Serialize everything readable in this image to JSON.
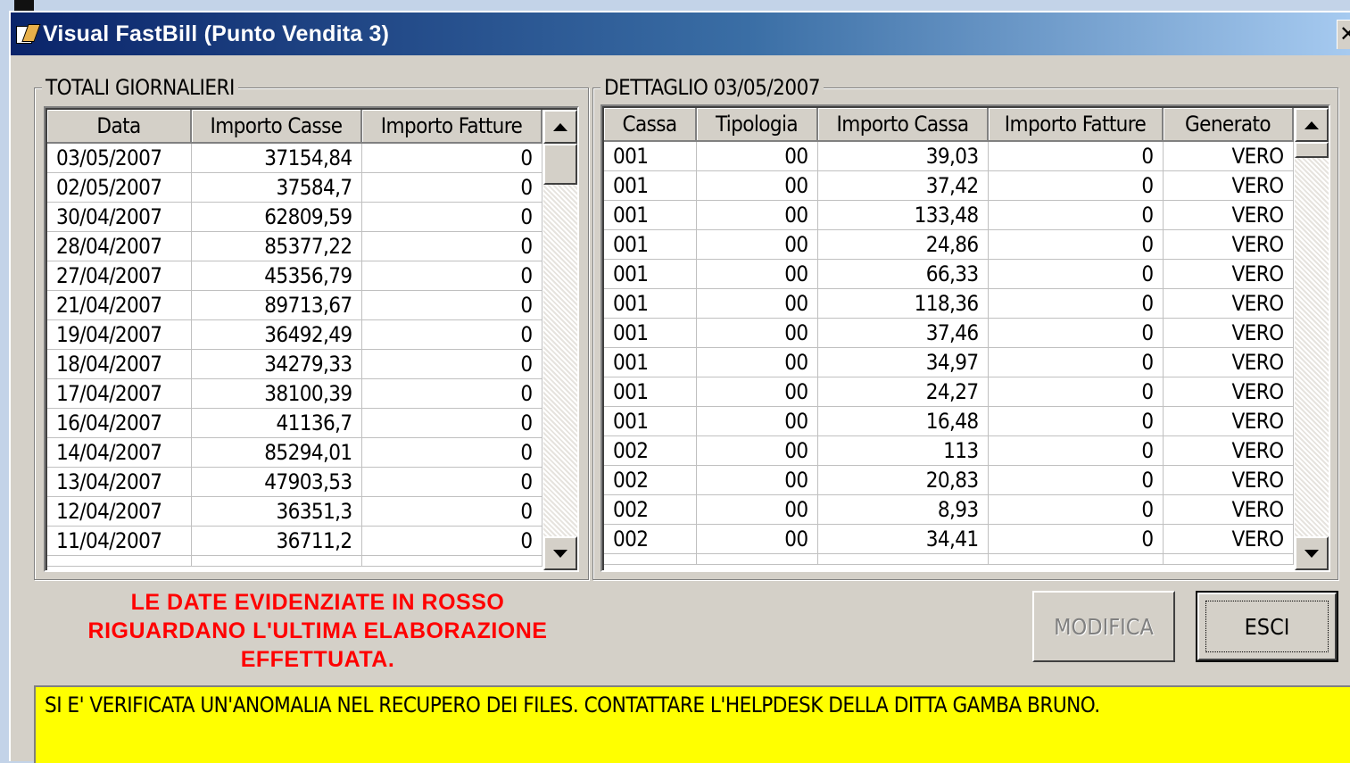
{
  "window": {
    "title": "Visual FastBill (Punto Vendita 3)",
    "close_label": "✕"
  },
  "left_panel": {
    "label": "TOTALI GIORNALIERI",
    "columns": [
      "Data",
      "Importo Casse",
      "Importo Fatture"
    ],
    "rows": [
      [
        "03/05/2007",
        "37154,84",
        "0"
      ],
      [
        "02/05/2007",
        "37584,7",
        "0"
      ],
      [
        "30/04/2007",
        "62809,59",
        "0"
      ],
      [
        "28/04/2007",
        "85377,22",
        "0"
      ],
      [
        "27/04/2007",
        "45356,79",
        "0"
      ],
      [
        "21/04/2007",
        "89713,67",
        "0"
      ],
      [
        "19/04/2007",
        "36492,49",
        "0"
      ],
      [
        "18/04/2007",
        "34279,33",
        "0"
      ],
      [
        "17/04/2007",
        "38100,39",
        "0"
      ],
      [
        "16/04/2007",
        "41136,7",
        "0"
      ],
      [
        "14/04/2007",
        "85294,01",
        "0"
      ],
      [
        "13/04/2007",
        "47903,53",
        "0"
      ],
      [
        "12/04/2007",
        "36351,3",
        "0"
      ],
      [
        "11/04/2007",
        "36711,2",
        "0"
      ]
    ]
  },
  "right_panel": {
    "label": "DETTAGLIO 03/05/2007",
    "columns": [
      "Cassa",
      "Tipologia",
      "Importo Cassa",
      "Importo Fatture",
      "Generato"
    ],
    "rows": [
      [
        "001",
        "00",
        "39,03",
        "0",
        "VERO"
      ],
      [
        "001",
        "00",
        "37,42",
        "0",
        "VERO"
      ],
      [
        "001",
        "00",
        "133,48",
        "0",
        "VERO"
      ],
      [
        "001",
        "00",
        "24,86",
        "0",
        "VERO"
      ],
      [
        "001",
        "00",
        "66,33",
        "0",
        "VERO"
      ],
      [
        "001",
        "00",
        "118,36",
        "0",
        "VERO"
      ],
      [
        "001",
        "00",
        "37,46",
        "0",
        "VERO"
      ],
      [
        "001",
        "00",
        "34,97",
        "0",
        "VERO"
      ],
      [
        "001",
        "00",
        "24,27",
        "0",
        "VERO"
      ],
      [
        "001",
        "00",
        "16,48",
        "0",
        "VERO"
      ],
      [
        "002",
        "00",
        "113",
        "0",
        "VERO"
      ],
      [
        "002",
        "00",
        "20,83",
        "0",
        "VERO"
      ],
      [
        "002",
        "00",
        "8,93",
        "0",
        "VERO"
      ],
      [
        "002",
        "00",
        "34,41",
        "0",
        "VERO"
      ]
    ]
  },
  "notice": {
    "line1": "LE DATE EVIDENZIATE IN ROSSO",
    "line2": "RIGUARDANO L'ULTIMA ELABORAZIONE",
    "line3": "EFFETTUATA."
  },
  "buttons": {
    "modifica": "MODIFICA",
    "esci": "ESCI"
  },
  "status": {
    "message": "SI E' VERIFICATA UN'ANOMALIA NEL RECUPERO DEI FILES. CONTATTARE L'HELPDESK DELLA DITTA GAMBA BRUNO."
  },
  "colors": {
    "notice": "#ff0000",
    "status_bg": "#ffff00",
    "titlebar": "#0a246a"
  }
}
